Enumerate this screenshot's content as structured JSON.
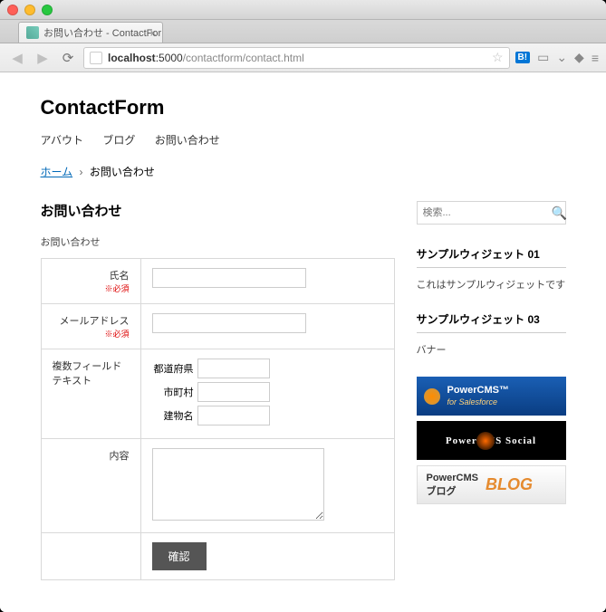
{
  "browser": {
    "tab_title": "お問い合わせ - ContactFor…",
    "url_host": "localhost",
    "url_port": ":5000",
    "url_path": "/contactform/contact.html"
  },
  "site": {
    "title": "ContactForm",
    "nav": [
      "アバウト",
      "ブログ",
      "お問い合わせ"
    ]
  },
  "breadcrumb": {
    "home": "ホーム",
    "current": "お問い合わせ"
  },
  "page": {
    "heading": "お問い合わせ",
    "lead": "お問い合わせ"
  },
  "form": {
    "fields": {
      "name": {
        "label": "氏名",
        "required": "※必須"
      },
      "email": {
        "label": "メールアドレス",
        "required": "※必須"
      },
      "multi": {
        "label": "複数フィールドテキスト",
        "sub": {
          "pref": "都道府県",
          "city": "市町村",
          "building": "建物名"
        }
      },
      "content": {
        "label": "内容"
      }
    },
    "submit": "確認"
  },
  "sidebar": {
    "search_placeholder": "検索...",
    "widgets": [
      {
        "title": "サンプルウィジェット 01",
        "body": "これはサンプルウィジェットです"
      },
      {
        "title": "サンプルウィジェット 03",
        "body": "バナー"
      }
    ],
    "banners": {
      "sf": {
        "line1": "PowerCMS™",
        "line2": "for Salesforce"
      },
      "social": {
        "text": "PowerCMS Social"
      },
      "blog": {
        "line1": "PowerCMS",
        "line2": "ブログ",
        "big": "BLOG"
      }
    }
  }
}
